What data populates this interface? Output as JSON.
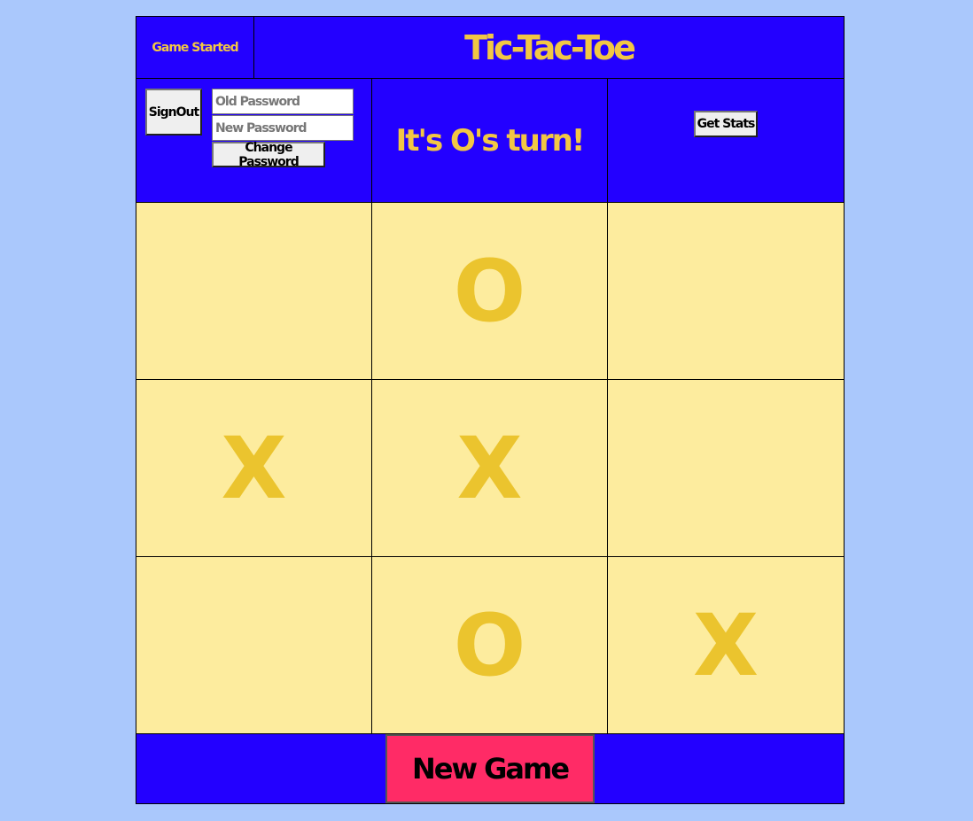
{
  "header": {
    "status": "Game Started",
    "title": "Tic-Tac-Toe"
  },
  "account": {
    "sign_out_line1": "Sign",
    "sign_out_line2": "Out",
    "old_password_placeholder": "Old Password",
    "new_password_placeholder": "New Password",
    "change_password_label": "Change Password"
  },
  "turn_message": "It's O's turn!",
  "stats": {
    "get_stats_label": "Get Stats"
  },
  "board": {
    "cells": [
      "",
      "O",
      "",
      "X",
      "X",
      "",
      "",
      "O",
      "X"
    ]
  },
  "footer": {
    "new_game_label": "New Game"
  },
  "colors": {
    "page_background": "#aac8fc",
    "panel_blue": "#2300ff",
    "accent_yellow": "#f2c744",
    "cell_background": "#fdec9e",
    "mark_color": "#ebc42e",
    "new_game_pink": "#ff2b66"
  }
}
